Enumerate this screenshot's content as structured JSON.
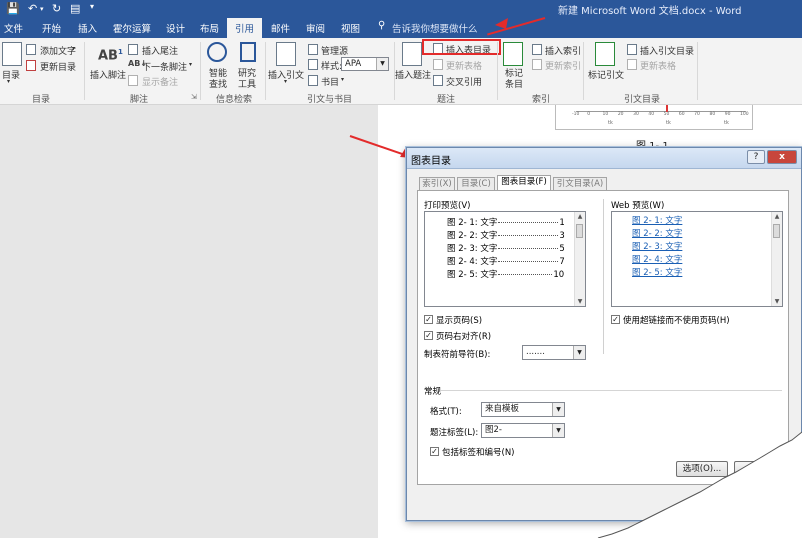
{
  "window": {
    "title": "新建 Microsoft Word 文档.docx - Word"
  },
  "tabs": [
    "文件",
    "开始",
    "插入",
    "霍尔运算",
    "设计",
    "布局",
    "引用",
    "邮件",
    "审阅",
    "视图"
  ],
  "active_tab": "引用",
  "tell_me": "告诉我你想要做什么",
  "ribbon": {
    "toc": {
      "toc_label": "目录",
      "add_text": "添加文字",
      "update_toc": "更新目录",
      "group": "目录"
    },
    "footnotes": {
      "insert_footnote": "插入脚注",
      "insert_endnote": "插入尾注",
      "next_footnote": "下一条脚注",
      "show_notes": "显示备注",
      "group": "脚注"
    },
    "research": {
      "smart_lookup_1": "智能",
      "smart_lookup_2": "查找",
      "researcher_1": "研究",
      "researcher_2": "工具",
      "group": "信息检索"
    },
    "citations": {
      "insert_citation": "插入引文",
      "manage_sources": "管理源",
      "style_label": "样式:",
      "style_value": "APA",
      "bibliography": "书目",
      "group": "引文与书目"
    },
    "captions": {
      "insert_caption": "插入题注",
      "insert_tof": "插入表目录",
      "update_table": "更新表格",
      "cross_reference": "交叉引用",
      "group": "题注"
    },
    "index": {
      "mark_entry_1": "标记",
      "mark_entry_2": "条目",
      "insert_index": "插入索引",
      "update_index": "更新索引",
      "group": "索引"
    },
    "toa": {
      "mark_citation": "标记引文",
      "insert_toa": "插入引文目录",
      "update_toa": "更新表格",
      "group": "引文目录"
    }
  },
  "document": {
    "figure_caption": "图 1- 1",
    "chart_ticks": [
      "-10",
      "0",
      "10",
      "20",
      "30",
      "40",
      "50",
      "60",
      "70",
      "80",
      "90",
      "100"
    ],
    "chart_axis": [
      "tk",
      "tk",
      "tk"
    ]
  },
  "dialog": {
    "title": "图表目录",
    "help": "?",
    "close": "x",
    "tabs": [
      "索引(X)",
      "目录(C)",
      "图表目录(F)",
      "引文目录(A)"
    ],
    "selected_tab": "图表目录(F)",
    "print_preview_label": "打印预览(V)",
    "print_preview_rows": [
      {
        "label": "图 2- 1:",
        "text": "文字",
        "page": "1"
      },
      {
        "label": "图 2- 2:",
        "text": "文字",
        "page": "3"
      },
      {
        "label": "图 2- 3:",
        "text": "文字",
        "page": "5"
      },
      {
        "label": "图 2- 4:",
        "text": "文字",
        "page": "7"
      },
      {
        "label": "图 2- 5:",
        "text": "文字",
        "page": "10"
      }
    ],
    "web_preview_label": "Web 预览(W)",
    "web_preview_rows": [
      "图 2- 1: 文字",
      "图 2- 2: 文字",
      "图 2- 3: 文字",
      "图 2- 4: 文字",
      "图 2- 5: 文字"
    ],
    "show_page_numbers": "显示页码(S)",
    "right_align": "页码右对齐(R)",
    "use_hyperlinks": "使用超链接而不使用页码(H)",
    "tab_leader_label": "制表符前导符(B):",
    "tab_leader_value": ".......",
    "general_label": "常规",
    "formats_label": "格式(T):",
    "formats_value": "来自模板",
    "caption_label": "题注标签(L):",
    "caption_value": "图2-",
    "include_label": "包括标签和编号(N)",
    "options_button": "选项(O)..."
  }
}
